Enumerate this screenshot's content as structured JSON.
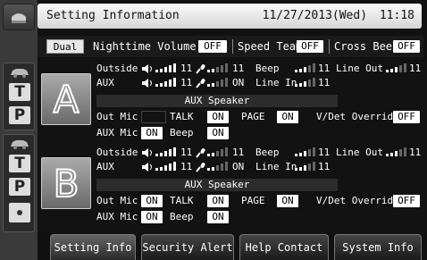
{
  "header": {
    "title": "Setting Information",
    "date": "11/27/2013(Wed)",
    "time": "11:18"
  },
  "status": {
    "mode": "Dual",
    "nighttime_volume_label": "Nighttime Volume",
    "nighttime_volume_value": "OFF",
    "speed_team_label": "Speed Team",
    "speed_team_value": "OFF",
    "cross_beep_label": "Cross Beep",
    "cross_beep_value": "OFF"
  },
  "sections": [
    {
      "letter": "A",
      "outside_label": "Outside",
      "outside_spk_value": "11",
      "outside_mic_value": "11",
      "aux_label": "AUX",
      "aux_spk_value": "11",
      "aux_mic_value": "ON",
      "beep_label": "Beep",
      "beep_value": "11",
      "line_in_label": "Line In",
      "line_in_value": "11",
      "line_out_label": "Line Out",
      "line_out_value": "11",
      "aux_speaker_label": "AUX Speaker",
      "out_mic_label": "Out Mic",
      "out_mic_value": "",
      "talk_label": "TALK",
      "talk_value": "ON",
      "page_label": "PAGE",
      "page_value": "ON",
      "vdet_label": "V/Det Override",
      "vdet_value": "OFF",
      "aux_mic_label": "AUX Mic",
      "beep2_label": "Beep",
      "beep2_value": "ON"
    },
    {
      "letter": "B",
      "outside_label": "Outside",
      "outside_spk_value": "11",
      "outside_mic_value": "11",
      "aux_label": "AUX",
      "aux_spk_value": "11",
      "aux_mic_value": "ON",
      "beep_label": "Beep",
      "beep_value": "11",
      "line_in_label": "Line In",
      "line_in_value": "11",
      "line_out_label": "Line Out",
      "line_out_value": "11",
      "aux_speaker_label": "AUX Speaker",
      "out_mic_label": "Out Mic",
      "out_mic_value": "ON",
      "talk_label": "TALK",
      "talk_value": "ON",
      "page_label": "PAGE",
      "page_value": "ON",
      "vdet_label": "V/Det Override",
      "vdet_value": "OFF",
      "aux_mic_label": "AUX Mic",
      "beep2_label": "Beep",
      "beep2_value": "ON"
    }
  ],
  "sidebar": {
    "t_glyph": "T",
    "p_glyph": "P"
  },
  "tabs": [
    {
      "label": "Setting Info",
      "active": true
    },
    {
      "label": "Security Alert",
      "active": false
    },
    {
      "label": "Help Contact",
      "active": false
    },
    {
      "label": "System Info",
      "active": false
    }
  ],
  "colors": {
    "background": "#000000",
    "header_bg": "#f0f0f0",
    "badge_bg": "#ffffff",
    "text": "#ffffff"
  }
}
